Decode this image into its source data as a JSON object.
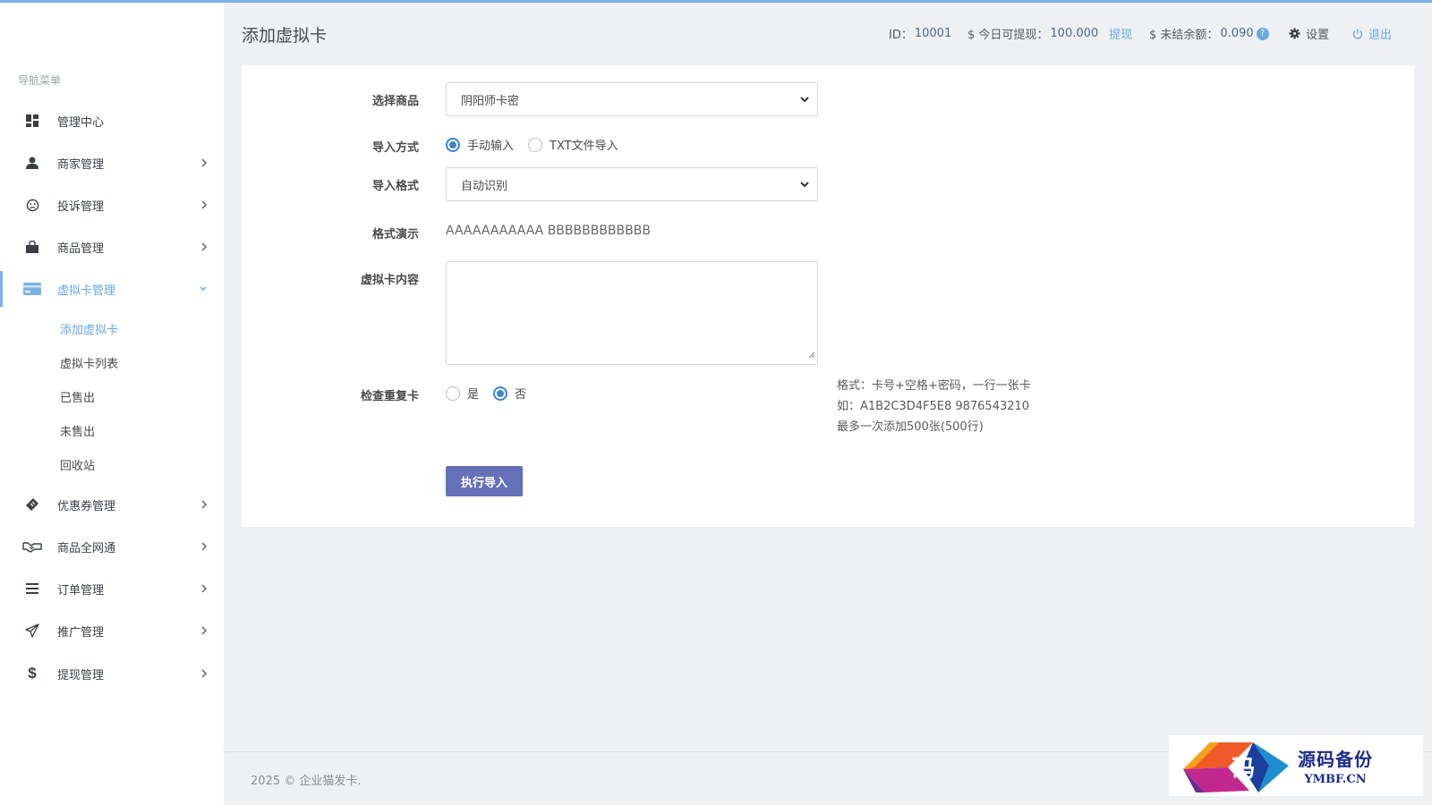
{
  "colors": {
    "accent": "#6aa8e0",
    "primary_button": "#6570b8",
    "radio_checked": "#3b82d6"
  },
  "sidebar": {
    "title": "导航菜单",
    "items": [
      {
        "label": "管理中心",
        "icon": "dashboard-icon"
      },
      {
        "label": "商家管理",
        "icon": "user-icon"
      },
      {
        "label": "投诉管理",
        "icon": "frown-icon"
      },
      {
        "label": "商品管理",
        "icon": "shopping-bag-icon"
      },
      {
        "label": "虚拟卡管理",
        "icon": "credit-card-icon",
        "active": true
      },
      {
        "label": "优惠券管理",
        "icon": "ticket-icon"
      },
      {
        "label": "商品全网通",
        "icon": "handshake-icon"
      },
      {
        "label": "订单管理",
        "icon": "list-icon"
      },
      {
        "label": "推广管理",
        "icon": "paper-plane-icon"
      },
      {
        "label": "提现管理",
        "icon": "dollar-icon"
      }
    ],
    "sub_items": [
      "添加虚拟卡",
      "虚拟卡列表",
      "已售出",
      "未售出",
      "回收站"
    ]
  },
  "header": {
    "title": "添加虚拟卡",
    "id_label": "ID：",
    "id_value": "10001",
    "withdrawable_label": "$ 今日可提现：",
    "withdrawable_value": "100.000",
    "withdraw_link": "提现",
    "unsettled_label": "$ 未结余额：",
    "unsettled_value": "0.090",
    "help_mark": "?",
    "settings": "设置",
    "logout": "退出"
  },
  "form": {
    "product_label": "选择商品",
    "product_value": "阴阳师卡密",
    "import_method_label": "导入方式",
    "import_method_options": [
      "手动输入",
      "TXT文件导入"
    ],
    "import_method_selected": "手动输入",
    "format_label": "导入格式",
    "format_value": "自动识别",
    "demo_label": "格式演示",
    "demo_value": "AAAAAAAAAAA BBBBBBBBBBBB",
    "content_label": "虚拟卡内容",
    "content_value": "",
    "dup_check_label": "检查重复卡",
    "dup_check_options": [
      "是",
      "否"
    ],
    "dup_check_selected": "否",
    "help_lines": [
      "格式：卡号+空格+密码，一行一张卡",
      "如：A1B2C3D4F5E8 9876543210",
      "最多一次添加500张(500行)"
    ],
    "submit": "执行导入"
  },
  "footer": "2025 © 企业猫发卡.",
  "watermark": {
    "text_cn": "源码备份",
    "text_en": "YMBF.CN",
    "logo_char": "码"
  }
}
